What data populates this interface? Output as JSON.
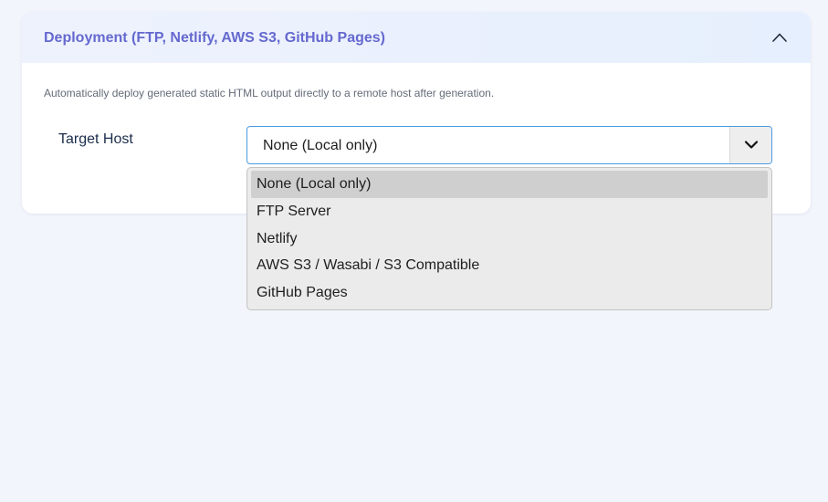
{
  "section": {
    "title": "Deployment (FTP, Netlify, AWS S3, GitHub Pages)",
    "collapse_icon": "chevron-up-icon",
    "description": "Automatically deploy generated static HTML output directly to a remote host after generation."
  },
  "target_host": {
    "label": "Target Host",
    "selected_value": "None (Local only)",
    "arrow_icon": "chevron-down-icon",
    "options": [
      {
        "label": "None (Local only)",
        "selected": true
      },
      {
        "label": "FTP Server",
        "selected": false
      },
      {
        "label": "Netlify",
        "selected": false
      },
      {
        "label": "AWS S3 / Wasabi / S3 Compatible",
        "selected": false
      },
      {
        "label": "GitHub Pages",
        "selected": false
      }
    ]
  },
  "colors": {
    "accent": "#6569cf",
    "focus_border": "#4a9be0",
    "page_background": "#f3f5fc"
  }
}
